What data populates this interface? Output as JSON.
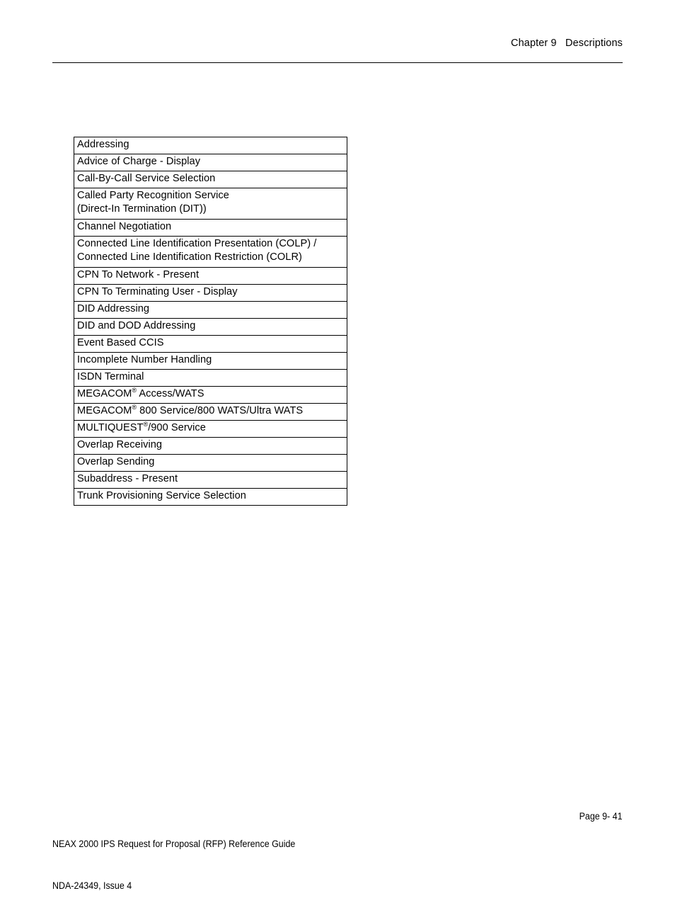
{
  "header": {
    "chapter_label": "Chapter 9   Descriptions"
  },
  "table": {
    "name": "isdn-feature-list",
    "rows": [
      {
        "text": "Addressing",
        "lines": 1
      },
      {
        "text": "Advice of Charge - Display",
        "lines": 1
      },
      {
        "text": "Call-By-Call Service Selection",
        "lines": 1
      },
      {
        "text": "Called Party Recognition Service\n(Direct-In Termination (DIT))",
        "lines": 2
      },
      {
        "text": "Channel Negotiation",
        "lines": 1
      },
      {
        "text": "Connected Line Identification Presentation (COLP) /\nConnected Line Identification Restriction (COLR)",
        "lines": 2
      },
      {
        "text": "CPN To Network - Present",
        "lines": 1
      },
      {
        "text": "CPN To Terminating User - Display",
        "lines": 1
      },
      {
        "text": "DID Addressing",
        "lines": 1
      },
      {
        "text": "DID and DOD Addressing",
        "lines": 1
      },
      {
        "text": "Event Based CCIS",
        "lines": 1
      },
      {
        "text": "Incomplete Number Handling",
        "lines": 1
      },
      {
        "text": "ISDN Terminal",
        "lines": 1
      },
      {
        "text": "MEGACOM® Access/WATS",
        "lines": 1,
        "prefix": "MEGACOM",
        "sup": "®",
        "suffix": " Access/WATS"
      },
      {
        "text": "MEGACOM® 800 Service/800 WATS/Ultra WATS",
        "lines": 1,
        "prefix": "MEGACOM",
        "sup": "®",
        "suffix": " 800 Service/800 WATS/Ultra WATS"
      },
      {
        "text": "MULTIQUEST®/900 Service",
        "lines": 1,
        "prefix": "MULTIQUEST",
        "sup": "®",
        "suffix": "/900 Service"
      },
      {
        "text": "Overlap Receiving",
        "lines": 1
      },
      {
        "text": "Overlap Sending",
        "lines": 1
      },
      {
        "text": "Subaddress - Present",
        "lines": 1
      },
      {
        "text": "Trunk Provisioning Service Selection",
        "lines": 1
      }
    ]
  },
  "footer": {
    "guide_title": "NEAX 2000 IPS Request for Proposal (RFP) Reference Guide",
    "document_number": "NDA-24349, Issue 4",
    "page_number": "Page 9- 41"
  }
}
